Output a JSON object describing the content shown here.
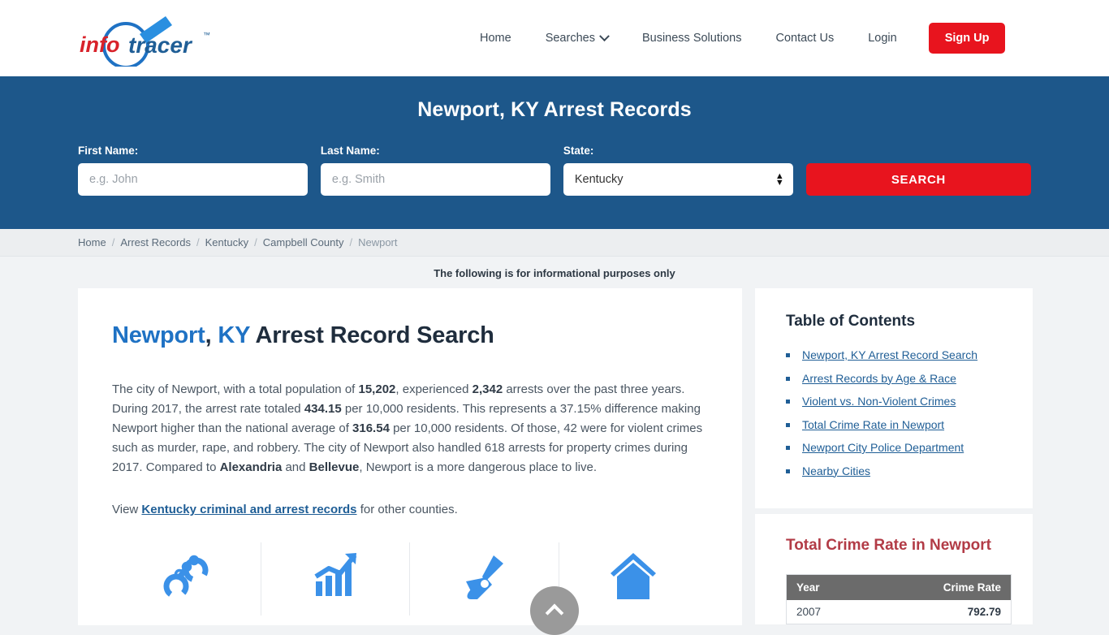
{
  "header": {
    "logo": {
      "part1": "info",
      "part2": "tracer",
      "tm": "™",
      "icon": "magnifier-logo-icon",
      "color_part1": "#d8222a",
      "color_part2": "#1f72c4"
    },
    "nav": [
      {
        "label": "Home",
        "name": "nav-home"
      },
      {
        "label": "Searches",
        "name": "nav-searches",
        "has_dropdown": true
      },
      {
        "label": "Business Solutions",
        "name": "nav-business-solutions"
      },
      {
        "label": "Contact Us",
        "name": "nav-contact-us"
      },
      {
        "label": "Login",
        "name": "nav-login"
      }
    ],
    "signup_label": "Sign Up"
  },
  "hero": {
    "title": "Newport, KY Arrest Records",
    "bg_color": "#1d578a",
    "first_name": {
      "label": "First Name:",
      "value": "",
      "placeholder": "e.g. John"
    },
    "last_name": {
      "label": "Last Name:",
      "value": "",
      "placeholder": "e.g. Smith"
    },
    "state": {
      "label": "State:",
      "value": "Kentucky",
      "options": [
        "Kentucky"
      ]
    },
    "search_label": "SEARCH",
    "search_color": "#e8141e"
  },
  "breadcrumb": [
    {
      "label": "Home",
      "current": false
    },
    {
      "label": "Arrest Records",
      "current": false
    },
    {
      "label": "Kentucky",
      "current": false
    },
    {
      "label": "Campbell County",
      "current": false
    },
    {
      "label": "Newport",
      "current": true
    }
  ],
  "breadcrumb_separator": "/",
  "notice": "The following is for informational purposes only",
  "main": {
    "heading": {
      "city": "Newport",
      "comma": ", ",
      "state_abbr": "KY",
      "rest": " Arrest Record Search"
    },
    "paragraph": {
      "p1": "The city of Newport, with a total population of ",
      "b1": "15,202",
      "p2": ", experienced ",
      "b2": "2,342",
      "p3": " arrests over the past three years. During 2017, the arrest rate totaled ",
      "b3": "434.15",
      "p4": " per 10,000 residents. This represents a 37.15% difference making Newport higher than the national average of ",
      "b4": "316.54",
      "p5": " per 10,000 residents. Of those, 42 were for violent crimes such as murder, rape, and robbery. The city of Newport also handled 618 arrests for property crimes during 2017. Compared to ",
      "b5": "Alexandria",
      "p6": " and ",
      "b6": "Bellevue",
      "p7": ", Newport is a more dangerous place to live."
    },
    "view_line": {
      "prefix": "View ",
      "link": "Kentucky criminal and arrest records",
      "suffix": " for other counties."
    },
    "icons": [
      {
        "name": "handcuffs-icon",
        "label": "handcuffs"
      },
      {
        "name": "growth-chart-icon",
        "label": "arrest trend chart"
      },
      {
        "name": "gun-icon",
        "label": "violent crime gun"
      },
      {
        "name": "house-icon",
        "label": "property crime house"
      }
    ],
    "icon_color": "#3b91e8"
  },
  "sidebar": {
    "toc_title": "Table of Contents",
    "toc_items": [
      "Newport, KY Arrest Record Search",
      "Arrest Records by Age & Race",
      "Violent vs. Non-Violent Crimes",
      "Total Crime Rate in Newport",
      "Newport City Police Department",
      "Nearby Cities"
    ],
    "crime_title": "Total Crime Rate in Newport",
    "crime_table": {
      "headers": [
        "Year",
        "Crime Rate"
      ],
      "rows": [
        {
          "year": "2007",
          "rate": "792.79"
        }
      ]
    }
  },
  "scroll_top": {
    "name": "scroll-to-top-button",
    "icon": "chevron-up-icon"
  }
}
